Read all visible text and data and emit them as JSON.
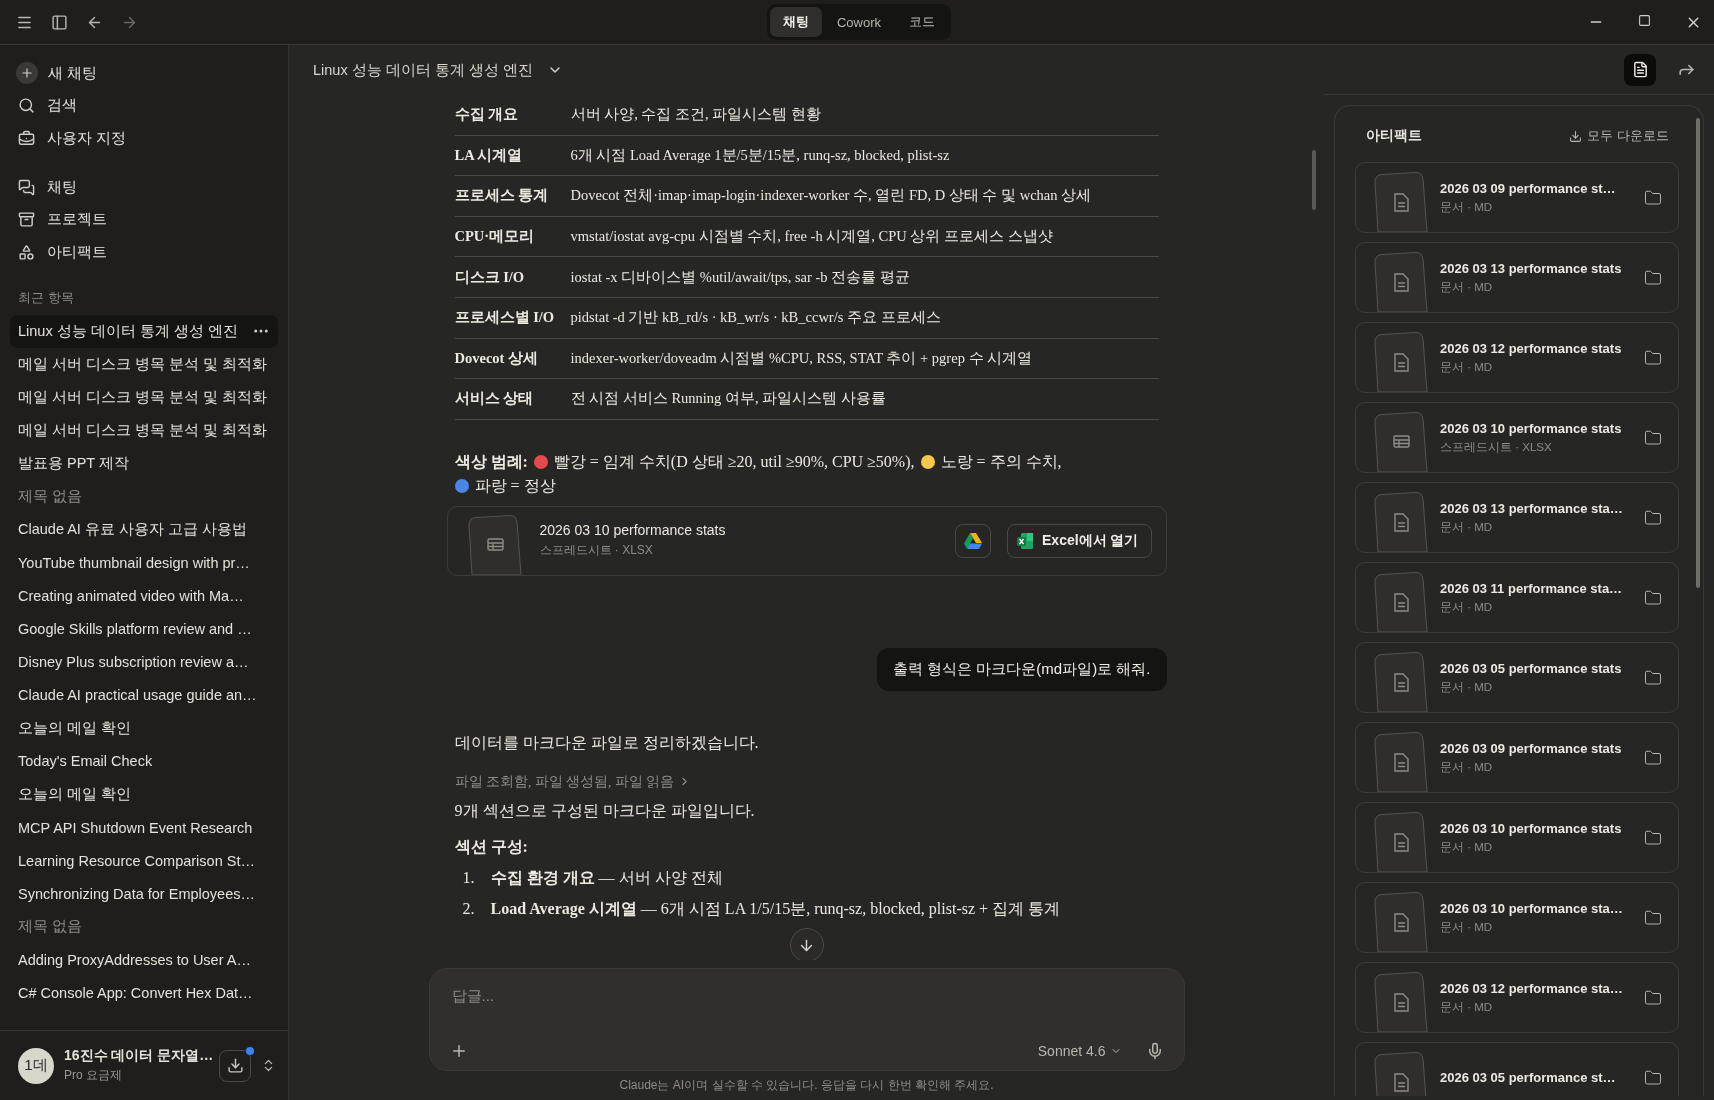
{
  "top_bar": {
    "nav": [
      {
        "kind": "menu",
        "disabled": false
      },
      {
        "kind": "sidebar",
        "disabled": false
      },
      {
        "kind": "back",
        "disabled": false
      },
      {
        "kind": "forward",
        "disabled": true
      }
    ],
    "tabs": [
      {
        "label": "채팅",
        "selected": true
      },
      {
        "label": "Cowork",
        "selected": false
      },
      {
        "label": "코드",
        "selected": false
      }
    ]
  },
  "sidebar": {
    "actions": [
      {
        "kind": "new",
        "label": "새 채팅"
      },
      {
        "kind": "search",
        "label": "검색"
      },
      {
        "kind": "customize",
        "label": "사용자 지정"
      }
    ],
    "nav": [
      {
        "kind": "chats",
        "label": "채팅"
      },
      {
        "kind": "projects",
        "label": "프로젝트"
      },
      {
        "kind": "artifacts",
        "label": "아티팩트"
      }
    ],
    "recent_title": "최근 항목",
    "recent": [
      {
        "title": "Linux 성능 데이터 통계 생성 엔진",
        "kind": "chat",
        "selected": true
      },
      {
        "title": "메일 서버 디스크 병목 분석 및 최적화",
        "kind": "chat",
        "selected": false
      },
      {
        "title": "메일 서버 디스크 병목 분석 및 최적화",
        "kind": "chat",
        "selected": false
      },
      {
        "title": "메일 서버 디스크 병목 분석 및 최적화",
        "kind": "chat",
        "selected": false
      },
      {
        "title": "발표용 PPT 제작",
        "kind": "chat",
        "selected": false
      },
      {
        "title": "제목 없음",
        "kind": "untitled",
        "selected": false
      },
      {
        "title": "Claude AI 유료 사용자 고급 사용법",
        "kind": "chat",
        "selected": false
      },
      {
        "title": "YouTube thumbnail design with pr…",
        "kind": "chat",
        "selected": false
      },
      {
        "title": "Creating animated video with Ma…",
        "kind": "chat",
        "selected": false
      },
      {
        "title": "Google Skills platform review and …",
        "kind": "chat",
        "selected": false
      },
      {
        "title": "Disney Plus subscription review a…",
        "kind": "chat",
        "selected": false
      },
      {
        "title": "Claude AI practical usage guide an…",
        "kind": "chat",
        "selected": false
      },
      {
        "title": "오늘의 메일 확인",
        "kind": "chat",
        "selected": false
      },
      {
        "title": "Today's Email Check",
        "kind": "chat",
        "selected": false
      },
      {
        "title": "오늘의 메일 확인",
        "kind": "chat",
        "selected": false
      },
      {
        "title": "MCP API Shutdown Event Research",
        "kind": "chat",
        "selected": false
      },
      {
        "title": "Learning Resource Comparison St…",
        "kind": "chat",
        "selected": false
      },
      {
        "title": "Synchronizing Data for Employees…",
        "kind": "chat",
        "selected": false
      },
      {
        "title": "제목 없음",
        "kind": "untitled",
        "selected": false
      },
      {
        "title": "Adding ProxyAddresses to User A…",
        "kind": "chat",
        "selected": false
      },
      {
        "title": "C# Console App: Convert Hex Dat…",
        "kind": "chat",
        "selected": false
      }
    ],
    "user": {
      "avatar": "1데",
      "name": "16진수 데이터 문자열…",
      "plan": "Pro 요금제",
      "notification": true
    }
  },
  "chat": {
    "title": "Linux 성능 데이터 통계 생성 엔진",
    "header_actions": [
      {
        "kind": "document",
        "selected": true
      },
      {
        "kind": "share",
        "selected": false
      }
    ],
    "table": [
      {
        "label": "수집 개요",
        "desc": "서버 사양, 수집 조건, 파일시스템 현황"
      },
      {
        "label": "LA 시계열",
        "desc": "6개 시점 Load Average 1분/5분/15분, runq-sz, blocked, plist-sz"
      },
      {
        "label": "프로세스 통계",
        "desc": "Dovecot 전체·imap·imap-login·indexer-worker 수, 열린 FD, D 상태 수 및 wchan 상세"
      },
      {
        "label": "CPU·메모리",
        "desc": "vmstat/iostat avg-cpu 시점별 수치, free -h 시계열, CPU 상위 프로세스 스냅샷"
      },
      {
        "label": "디스크 I/O",
        "desc": "iostat -x 디바이스별 %util/await/tps, sar -b 전송률 평균"
      },
      {
        "label": "프로세스별 I/O",
        "desc": "pidstat -d 기반 kB_rd/s · kB_wr/s · kB_ccwr/s 주요 프로세스"
      },
      {
        "label": "Dovecot 상세",
        "desc": "indexer-worker/doveadm 시점별 %CPU, RSS, STAT 추이 + pgrep 수 시계열"
      },
      {
        "label": "서비스 상태",
        "desc": "전 시점 서비스 Running 여부, 파일시스템 사용률"
      }
    ],
    "legend": {
      "label": "색상 범례:",
      "items": [
        {
          "color": "#e5484d",
          "text": "빨강 = 임계 수치(D 상태 ≥20, util ≥90%, CPU ≥50%),"
        },
        {
          "color": "#f2c94c",
          "text": "노랑 = 주의 수치,"
        },
        {
          "color": "#4a86e8",
          "text": "파랑 = 정상"
        }
      ]
    },
    "file_card": {
      "title": "2026 03 10 performance stats",
      "sub": "스프레드시트 · XLSX",
      "open_label": "Excel에서 열기"
    },
    "user_message": "출력 형식은 마크다운(md파일)로 해줘.",
    "assistant": {
      "intro": "데이터를 마크다운 파일로 정리하겠습니다.",
      "tool_summary": "파일 조회함, 파일 생성됨, 파일 읽음",
      "summary": "9개 섹션으로 구성된 마크다운 파일입니다.",
      "list_title": "섹션 구성:",
      "list": [
        {
          "number": "1.",
          "text": "**수집 환경 개요** — 서버 사양 전체"
        },
        {
          "number": "2.",
          "text": "**Load Average 시계열** — 6개 시점 LA 1/5/15분, runq-sz, blocked, plist-sz + 집계 통계"
        }
      ]
    },
    "composer": {
      "placeholder": "답글...",
      "model": "Sonnet 4.6"
    },
    "disclaimer": "Claude는 AI이며 실수할 수 있습니다. 응답을 다시 한번 확인해 주세요."
  },
  "artifacts": {
    "title": "아티팩트",
    "download_all": "모두 다운로드",
    "items": [
      {
        "title": "2026 03 09 performance st…",
        "sub": "문서 · MD",
        "kind": "doc"
      },
      {
        "title": "2026 03 13 performance stats",
        "sub": "문서 · MD",
        "kind": "doc"
      },
      {
        "title": "2026 03 12 performance stats",
        "sub": "문서 · MD",
        "kind": "doc"
      },
      {
        "title": "2026 03 10 performance stats",
        "sub": "스프레드시트 · XLSX",
        "kind": "sheet"
      },
      {
        "title": "2026 03 13 performance sta…",
        "sub": "문서 · MD",
        "kind": "doc"
      },
      {
        "title": "2026 03 11 performance sta…",
        "sub": "문서 · MD",
        "kind": "doc"
      },
      {
        "title": "2026 03 05 performance stats",
        "sub": "문서 · MD",
        "kind": "doc"
      },
      {
        "title": "2026 03 09 performance stats",
        "sub": "문서 · MD",
        "kind": "doc"
      },
      {
        "title": "2026 03 10 performance stats",
        "sub": "문서 · MD",
        "kind": "doc"
      },
      {
        "title": "2026 03 10 performance sta…",
        "sub": "문서 · MD",
        "kind": "doc"
      },
      {
        "title": "2026 03 12 performance sta…",
        "sub": "문서 · MD",
        "kind": "doc"
      },
      {
        "title": "2026 03 05 performance st…",
        "kind": "doc"
      }
    ]
  }
}
